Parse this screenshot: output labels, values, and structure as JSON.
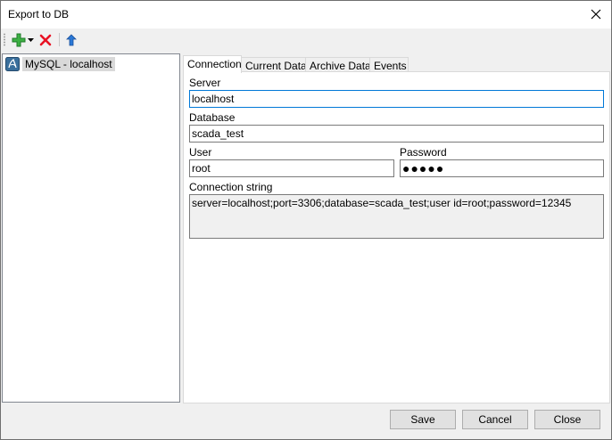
{
  "window": {
    "title": "Export to DB"
  },
  "toolbar": {
    "add_icon": "add-dropdown-icon",
    "delete_icon": "delete-icon",
    "move_up_icon": "move-up-icon"
  },
  "tree": {
    "items": [
      {
        "label": "MySQL - localhost",
        "icon": "mysql-icon"
      }
    ]
  },
  "tabs": [
    {
      "label": "Connection",
      "active": true
    },
    {
      "label": "Current Data",
      "active": false
    },
    {
      "label": "Archive Data",
      "active": false
    },
    {
      "label": "Events",
      "active": false
    }
  ],
  "connection": {
    "server_label": "Server",
    "server_value": "localhost",
    "database_label": "Database",
    "database_value": "scada_test",
    "user_label": "User",
    "user_value": "root",
    "password_label": "Password",
    "password_value": "●●●●●",
    "connstr_label": "Connection string",
    "connstr_value": "server=localhost;port=3306;database=scada_test;user id=root;password=12345"
  },
  "footer": {
    "save_label": "Save",
    "cancel_label": "Cancel",
    "close_label": "Close"
  },
  "colors": {
    "accent_focus": "#0078d7",
    "selection_bg": "#d9d9d9",
    "delete_red": "#e81123",
    "add_green": "#2ea043",
    "up_blue": "#1e6fd9"
  }
}
